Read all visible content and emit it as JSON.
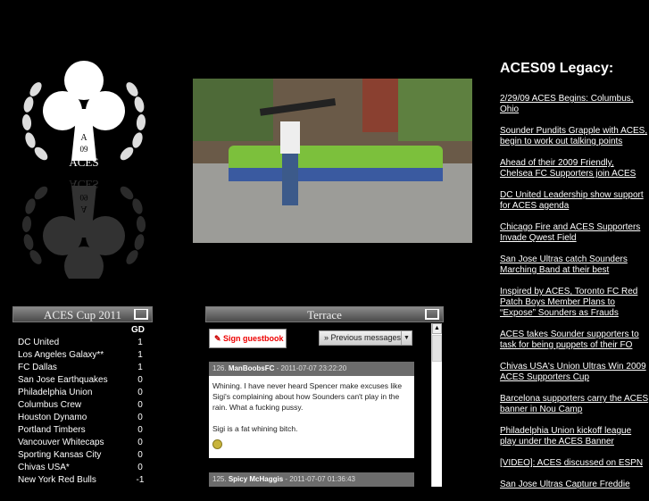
{
  "logo": {
    "text": "ACES",
    "year": "09",
    "letter": "A"
  },
  "cup": {
    "title": "ACES Cup 2011",
    "gd_header": "GD",
    "rows": [
      {
        "team": "DC United",
        "gd": "1"
      },
      {
        "team": "Los Angeles Galaxy**",
        "gd": "1"
      },
      {
        "team": "FC Dallas",
        "gd": "1"
      },
      {
        "team": "San Jose Earthquakes",
        "gd": "0"
      },
      {
        "team": "Philadelphia Union",
        "gd": "0"
      },
      {
        "team": "Columbus Crew",
        "gd": "0"
      },
      {
        "team": "Houston Dynamo",
        "gd": "0"
      },
      {
        "team": "Portland Timbers",
        "gd": "0"
      },
      {
        "team": "Vancouver Whitecaps",
        "gd": "0"
      },
      {
        "team": "Sporting Kansas City",
        "gd": "0"
      },
      {
        "team": "Chivas USA*",
        "gd": "0"
      },
      {
        "team": "New York Red Bulls",
        "gd": "-1"
      }
    ]
  },
  "terrace": {
    "title": "Terrace",
    "sign": "Sign guestbook",
    "prev": "» Previous messages",
    "messages": [
      {
        "num": "126.",
        "author": "ManBoobsFC",
        "date": "- 2011-07-07 23:22:20",
        "line1": "Whining. I have never heard Spencer make excuses like Sigi's complaining about how Sounders can't play in the rain. What a fucking pussy.",
        "line2": "Sigi is a fat whining bitch."
      },
      {
        "num": "125.",
        "author": "Spicy McHaggis",
        "date": "- 2011-07-07 01:36:43"
      }
    ]
  },
  "legacy": {
    "title": "ACES09 Legacy:",
    "links": [
      "2/29/09 ACES Begins: Columbus, Ohio",
      "Sounder Pundits Grapple with ACES, begin to work out talking points",
      "Ahead of their 2009 Friendly, Chelsea FC Supporters join ACES",
      "DC United Leadership show support for ACES agenda",
      "Chicago Fire and ACES Supporters Invade Qwest Field",
      "San Jose Ultras catch Sounders Marching Band at their best",
      "Inspired by ACES, Toronto FC Red Patch Boys Member Plans to “Expose” Sounders as Frauds",
      "ACES takes Sounder supporters to task for being puppets of their FO",
      "Chivas USA's Union Ultras Win 2009 ACES Supporters Cup",
      "Barcelona supporters carry the ACES banner in Nou Camp",
      "Philadelphia Union kickoff league play under the ACES Banner",
      "[VIDEO]: ACES discussed on ESPN",
      "San Jose Ultras Capture Freddie"
    ]
  }
}
